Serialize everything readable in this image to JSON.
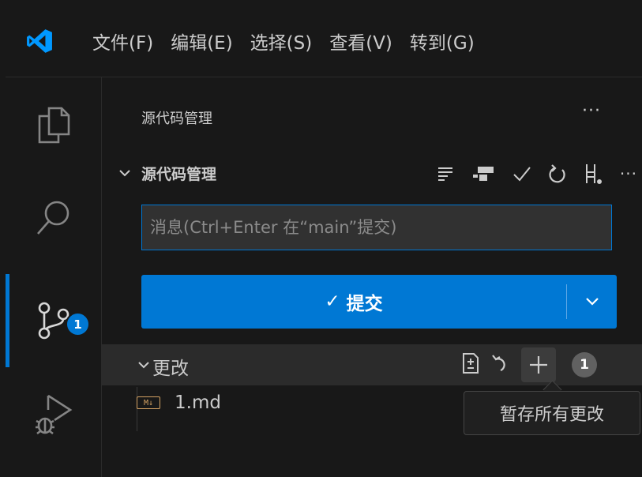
{
  "menu": {
    "items": [
      "文件(F)",
      "编辑(E)",
      "选择(S)",
      "查看(V)",
      "转到(G)"
    ]
  },
  "activity": {
    "items": [
      "explorer",
      "search",
      "source-control",
      "run-and-debug"
    ],
    "active": "source-control",
    "scm_badge": "1"
  },
  "sidebar": {
    "title": "源代码管理",
    "more": "···",
    "section": {
      "title": "源代码管理",
      "toolbar_icons": [
        "list-view-icon",
        "graph-icon",
        "check-icon",
        "refresh-icon",
        "branch-icon",
        "more-icon"
      ],
      "toolbar_more": "···"
    },
    "message": {
      "placeholder": "消息(Ctrl+Enter 在“main”提交)",
      "value": ""
    },
    "commit": {
      "check": "✓",
      "label": "提交"
    },
    "changes": {
      "label": "更改",
      "count": "1",
      "files": [
        {
          "icon": "M↓",
          "name": "1.md"
        }
      ]
    }
  },
  "tooltip": {
    "text": "暂存所有更改"
  },
  "colors": {
    "accent": "#0078d4",
    "background": "#181818",
    "foreground": "#cccccc",
    "markdown_icon": "#d4a263"
  }
}
